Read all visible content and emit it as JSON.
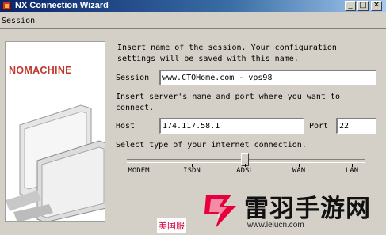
{
  "window": {
    "title": "NX Connection Wizard",
    "controls": {
      "minimize": "_",
      "maximize": "□",
      "close": "✕"
    }
  },
  "menu": {
    "session_label": "Session"
  },
  "banner": {
    "logo_text": "NOMACHINE"
  },
  "form": {
    "intro_line1": "Insert name of the session. Your configuration",
    "intro_line2": "settings will be saved with this name.",
    "session_label": "Session",
    "session_value": "www.CTOHome.com - vps98",
    "server_intro_line1": "Insert server's name and port where you want to",
    "server_intro_line2": "connect.",
    "host_label": "Host",
    "host_value": "174.117.58.1",
    "port_label": "Port",
    "port_value": "22",
    "connection_intro": "Select type of your internet connection.",
    "connection_types": [
      "MODEM",
      "ISDN",
      "ADSL",
      "WAN",
      "LAN"
    ],
    "connection_selected": "ADSL"
  },
  "watermark": {
    "brand": "雷羽手游网",
    "url": "www.leiucn.com",
    "tag": "美国服"
  },
  "colors": {
    "titlebar_start": "#0a246a",
    "titlebar_end": "#a6caf0",
    "logo_red": "#c0392b",
    "dialog_bg": "#d4d0c8",
    "watermark_red": "#e8003d"
  }
}
